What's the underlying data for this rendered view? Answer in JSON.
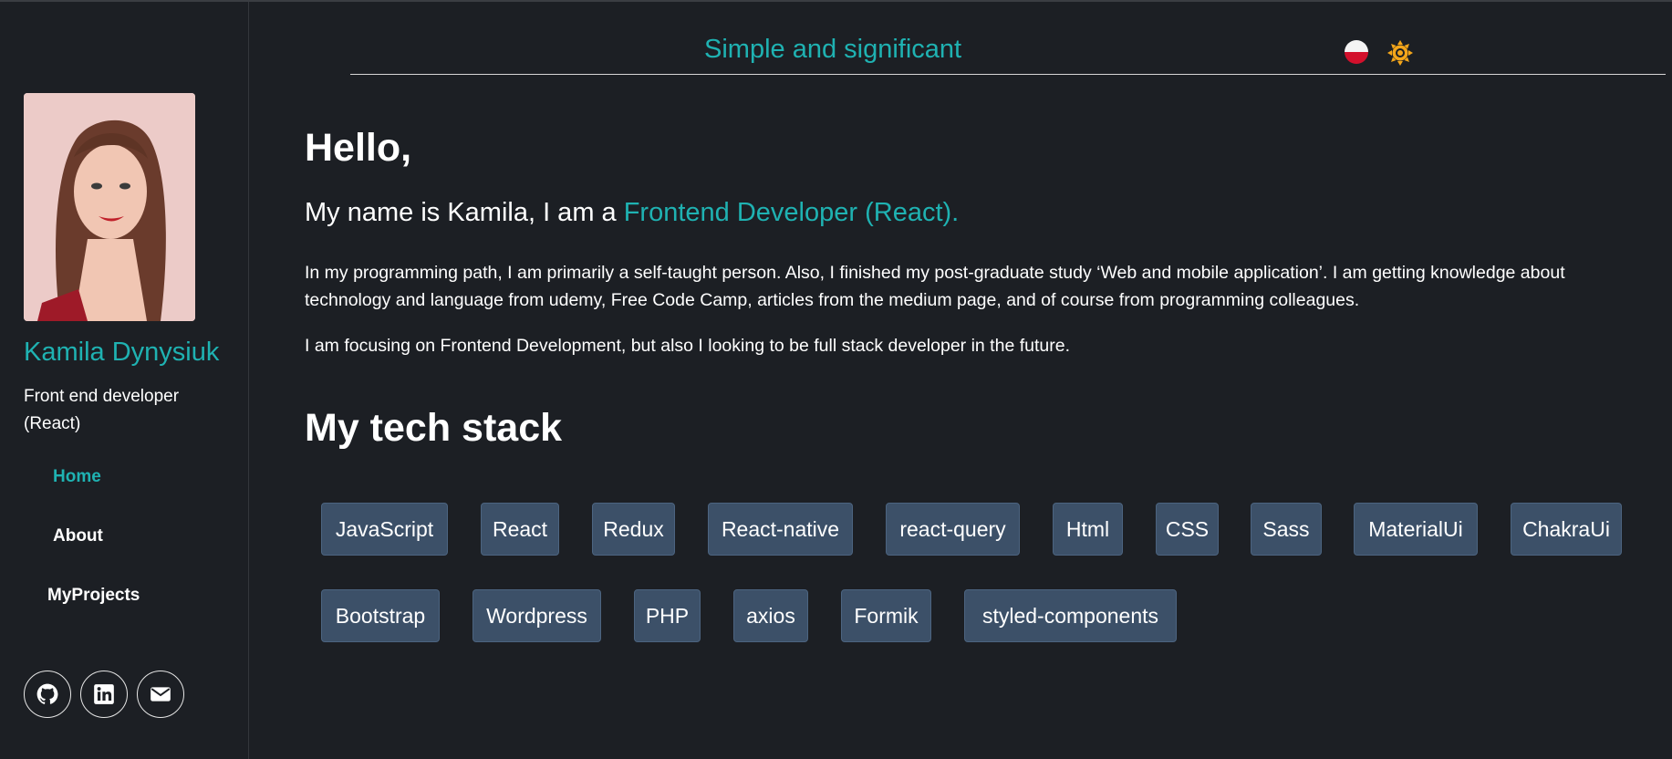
{
  "header": {
    "title": "Simple and significant",
    "language_flag_icon": "poland-flag-icon",
    "theme_icon": "sun-icon"
  },
  "profile": {
    "name": "Kamila Dynysiuk",
    "role": "Front end developer (React)"
  },
  "nav": {
    "items": [
      {
        "label": "Home",
        "active": true
      },
      {
        "label": "About",
        "active": false
      },
      {
        "label": "MyProjects",
        "active": false
      }
    ]
  },
  "socials": [
    "github-icon",
    "linkedin-icon",
    "mail-icon"
  ],
  "main": {
    "greeting": "Hello,",
    "intro_prefix": "My name is Kamila, I am a ",
    "intro_accent": "Frontend Developer (React).",
    "paragraph1": "In my programming path, I am primarily a self-taught person. Also, I finished my post-graduate study ‘Web and mobile application’. I am getting knowledge about technology and language from udemy, Free Code Camp, articles from the medium page, and of course from programming colleagues.",
    "paragraph2": "I am focusing on Frontend Development, but also I looking to be full stack developer in the future.",
    "tech_stack_heading": "My tech stack",
    "tech_stack": [
      "JavaScript",
      "React",
      "Redux",
      "React-native",
      "react-query",
      "Html",
      "CSS",
      "Sass",
      "MaterialUi",
      "ChakraUi",
      "Bootstrap",
      "Wordpress",
      "PHP",
      "axios",
      "Formik",
      "styled-components"
    ]
  },
  "colors": {
    "background": "#1c1f24",
    "accent": "#1fb2b2",
    "chip_background": "#3c5068",
    "sun": "#f4a61a"
  }
}
